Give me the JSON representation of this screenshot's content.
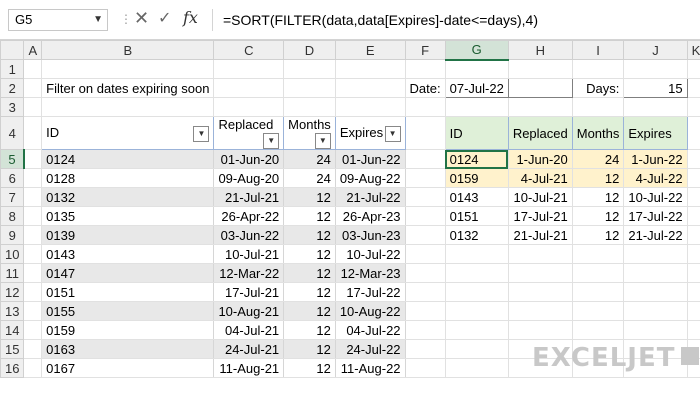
{
  "formula_bar": {
    "name_box": "G5",
    "formula": "=SORT(FILTER(data,data[Expires]-date<=days),4)",
    "icons": [
      "cancel-icon",
      "enter-icon",
      "fx-icon"
    ]
  },
  "columns": [
    "A",
    "B",
    "C",
    "D",
    "E",
    "F",
    "G",
    "H",
    "I",
    "J",
    "K"
  ],
  "selected_column": "G",
  "rows": [
    "1",
    "2",
    "3",
    "4",
    "5",
    "6",
    "7",
    "8",
    "9",
    "10",
    "11",
    "12",
    "13",
    "14",
    "15",
    "16"
  ],
  "selected_row": "5",
  "title": "Filter on dates expiring soon",
  "inputs": {
    "date_label": "Date:",
    "date_value": "07-Jul-22",
    "days_label": "Days:",
    "days_value": "15"
  },
  "data_table": {
    "headers": [
      "ID",
      "Replaced",
      "Months",
      "Expires"
    ],
    "rows": [
      [
        "0124",
        "01-Jun-20",
        "24",
        "01-Jun-22"
      ],
      [
        "0128",
        "09-Aug-20",
        "24",
        "09-Aug-22"
      ],
      [
        "0132",
        "21-Jul-21",
        "12",
        "21-Jul-22"
      ],
      [
        "0135",
        "26-Apr-22",
        "12",
        "26-Apr-23"
      ],
      [
        "0139",
        "03-Jun-22",
        "12",
        "03-Jun-23"
      ],
      [
        "0143",
        "10-Jul-21",
        "12",
        "10-Jul-22"
      ],
      [
        "0147",
        "12-Mar-22",
        "12",
        "12-Mar-23"
      ],
      [
        "0151",
        "17-Jul-21",
        "12",
        "17-Jul-22"
      ],
      [
        "0155",
        "10-Aug-21",
        "12",
        "10-Aug-22"
      ],
      [
        "0159",
        "04-Jul-21",
        "12",
        "04-Jul-22"
      ],
      [
        "0163",
        "24-Jul-21",
        "12",
        "24-Jul-22"
      ],
      [
        "0167",
        "11-Aug-21",
        "12",
        "11-Aug-22"
      ]
    ]
  },
  "result_table": {
    "headers": [
      "ID",
      "Replaced",
      "Months",
      "Expires"
    ],
    "rows": [
      [
        "0124",
        "1-Jun-20",
        "24",
        "1-Jun-22"
      ],
      [
        "0159",
        "4-Jul-21",
        "12",
        "4-Jul-22"
      ],
      [
        "0143",
        "10-Jul-21",
        "12",
        "10-Jul-22"
      ],
      [
        "0151",
        "17-Jul-21",
        "12",
        "17-Jul-22"
      ],
      [
        "0132",
        "21-Jul-21",
        "12",
        "21-Jul-22"
      ]
    ]
  },
  "watermark": "EXCELJET",
  "colors": {
    "accent_green": "#217346",
    "result_header_bg": "#dff0d8",
    "expired_highlight": "#fff2cc",
    "band": "#e8e8e8"
  }
}
